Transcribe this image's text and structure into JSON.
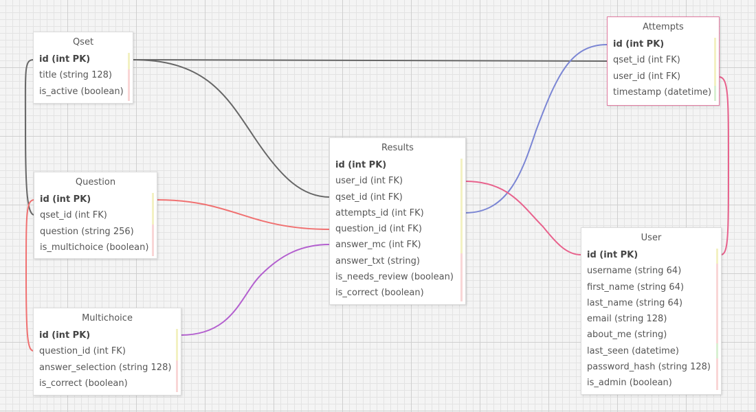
{
  "colors": {
    "link_dark": "#666666",
    "link_blue": "#7b86d4",
    "link_pink": "#e8618c",
    "link_red": "#f07070",
    "link_purple": "#b35fcf",
    "bar_yellow": "#f3f1c2",
    "bar_pink": "#f9d6d6",
    "bar_green": "#d8f0d2",
    "selected_border": "#e07aa0"
  },
  "tables": {
    "qset": {
      "title": "Qset",
      "fields": [
        "id (int PK)",
        "title (string 128)",
        "is_active (boolean)"
      ]
    },
    "question": {
      "title": "Question",
      "fields": [
        "id (int PK)",
        "qset_id (int FK)",
        "question (string 256)",
        "is_multichoice (boolean)"
      ]
    },
    "multichoice": {
      "title": "Multichoice",
      "fields": [
        "id (int PK)",
        "question_id (int FK)",
        "answer_selection (string 128)",
        "is_correct (boolean)"
      ]
    },
    "results": {
      "title": "Results",
      "fields": [
        "id (int PK)",
        "user_id (int FK)",
        "qset_id (int FK)",
        "attempts_id (int FK)",
        "question_id (int FK)",
        "answer_mc (int FK)",
        "answer_txt (string)",
        "is_needs_review (boolean)",
        "is_correct (boolean)"
      ]
    },
    "attempts": {
      "title": "Attempts",
      "fields": [
        "id (int PK)",
        "qset_id (int FK)",
        "user_id (int FK)",
        "timestamp (datetime)"
      ]
    },
    "user": {
      "title": "User",
      "fields": [
        "id (int PK)",
        "username (string 64)",
        "first_name (string 64)",
        "last_name (string 64)",
        "email (string 128)",
        "about_me (string)",
        "last_seen (datetime)",
        "password_hash (string 128)",
        "is_admin (boolean)"
      ]
    }
  }
}
